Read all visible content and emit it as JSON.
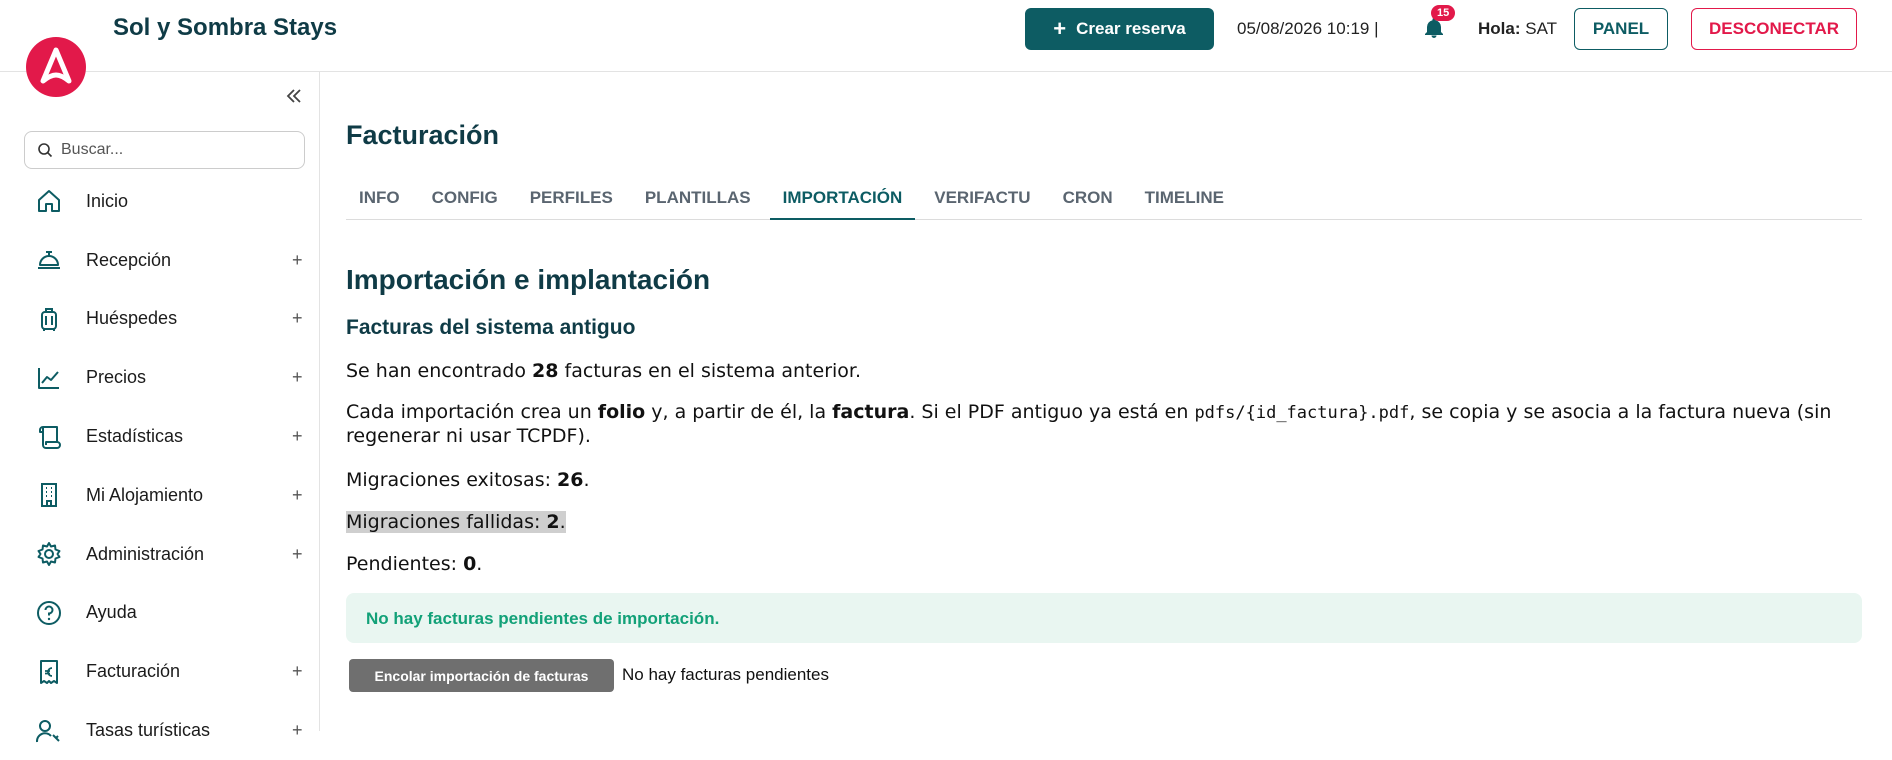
{
  "header": {
    "app_title": "Sol y Sombra Stays",
    "create_label": "Crear reserva",
    "datetime": "05/08/2026 10:19 |",
    "notifications_count": "15",
    "hello_label": "Hola:",
    "user": "SAT",
    "panel_label": "PANEL",
    "logout_label": "DESCONECTAR",
    "brand_color": "#e2194a",
    "accent_color": "#0d5c63"
  },
  "sidebar": {
    "search_placeholder": "Buscar...",
    "items": [
      {
        "label": "Inicio",
        "icon": "home-icon",
        "expandable": ""
      },
      {
        "label": "Recepción",
        "icon": "reception-bell-icon",
        "expandable": "+"
      },
      {
        "label": "Huéspedes",
        "icon": "luggage-icon",
        "expandable": "+"
      },
      {
        "label": "Precios",
        "icon": "chart-line-icon",
        "expandable": "+"
      },
      {
        "label": "Estadísticas",
        "icon": "scroll-icon",
        "expandable": "+"
      },
      {
        "label": "Mi Alojamiento",
        "icon": "building-icon",
        "expandable": "+"
      },
      {
        "label": "Administración",
        "icon": "gear-icon",
        "expandable": "+"
      },
      {
        "label": "Ayuda",
        "icon": "help-icon",
        "expandable": ""
      },
      {
        "label": "Facturación",
        "icon": "euro-receipt-icon",
        "expandable": "+"
      },
      {
        "label": "Tasas turísticas",
        "icon": "user-key-icon",
        "expandable": "+"
      }
    ]
  },
  "main": {
    "page_title": "Facturación",
    "tabs": [
      "INFO",
      "CONFIG",
      "PERFILES",
      "PLANTILLAS",
      "IMPORTACIÓN",
      "VERIFACTU",
      "CRON",
      "TIMELINE"
    ],
    "active_tab": "IMPORTACIÓN",
    "section_title": "Importación e implantación",
    "subsection_title": "Facturas del sistema antiguo",
    "found_prefix": "Se han encontrado ",
    "found_count": "28",
    "found_suffix": " facturas en el sistema anterior.",
    "info_1": "Cada importación crea un ",
    "info_folio": "folio",
    "info_2": " y, a partir de él, la ",
    "info_factura": "factura",
    "info_3": ". Si el PDF antiguo ya está en ",
    "info_path": "pdfs/{id_factura}.pdf",
    "info_4": ", se copia y se asocia a la factura nueva (sin regenerar ni usar TCPDF).",
    "success_label": "Migraciones exitosas: ",
    "success_count": "26",
    "failed_label": "Migraciones fallidas: ",
    "failed_count": "2",
    "pending_label": "Pendientes: ",
    "pending_count": "0",
    "alert_text": "No hay facturas pendientes de importación.",
    "queue_button": "Encolar importación de facturas",
    "queue_note": "No hay facturas pendientes"
  }
}
